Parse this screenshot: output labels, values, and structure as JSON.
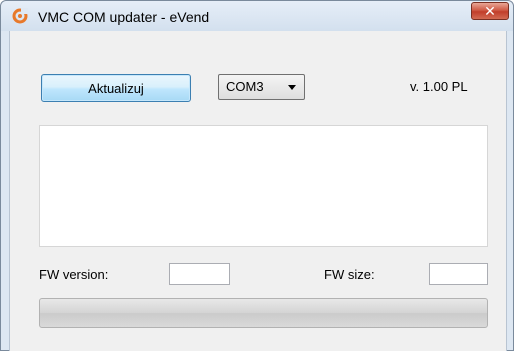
{
  "window": {
    "title": "VMC COM updater - eVend",
    "close_label": "✕",
    "icon": "app-logo-icon",
    "accent_color": "#e8792a"
  },
  "toolbar": {
    "update_label": "Aktualizuj",
    "port": {
      "selected": "COM3"
    },
    "version_text": "v. 1.00 PL"
  },
  "log": {
    "content": ""
  },
  "fw": {
    "version_label": "FW version:",
    "version_value": "",
    "size_label": "FW size:",
    "size_value": ""
  },
  "progress": {
    "percent": 0
  }
}
